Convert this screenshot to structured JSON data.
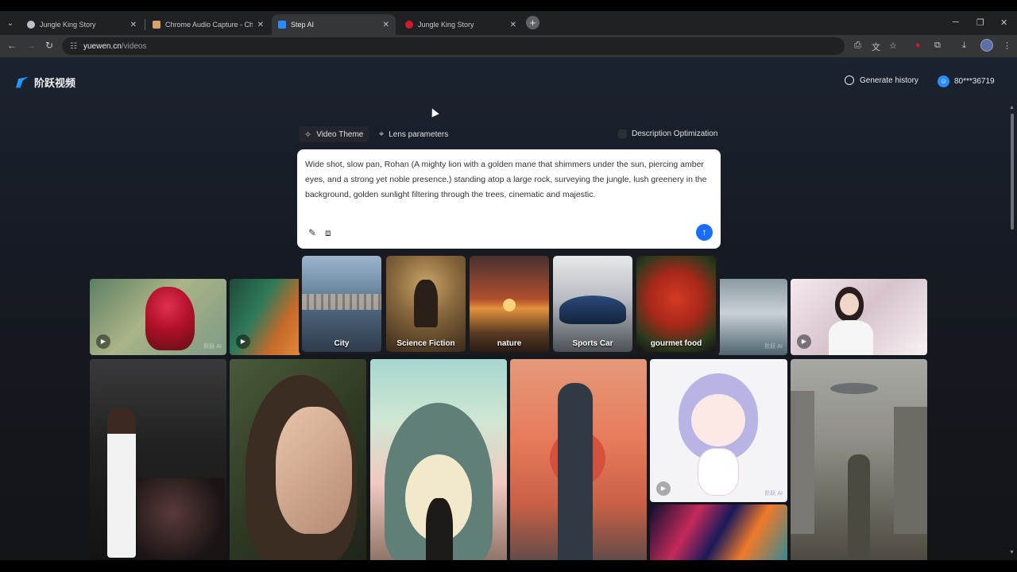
{
  "browser": {
    "tabs": [
      {
        "title": "Jungle King Story",
        "active": false,
        "favicon_color": "#bdc1c6"
      },
      {
        "title": "Chrome Audio Capture - Chrom",
        "active": false,
        "favicon_color": "#d7a36b"
      },
      {
        "title": "Step AI",
        "active": true,
        "favicon_color": "#2a8cff"
      },
      {
        "title": "Jungle King Story",
        "active": false,
        "favicon_color": "#d11a2a"
      }
    ],
    "url_host": "yuewen.cn",
    "url_path": "/videos"
  },
  "header": {
    "logo_text": "阶跃视频",
    "generate_history": "Generate history",
    "user_id": "80***36719"
  },
  "prompt": {
    "mode_tabs": [
      "Video Theme",
      "Lens parameters"
    ],
    "description_optimization": "Description Optimization",
    "text": "Wide shot, slow pan, Rohan (A mighty lion with a golden mane that shimmers under the sun, piercing amber eyes, and a strong yet noble presence.) standing atop a large rock, surveying the jungle, lush greenery in the background, golden sunlight filtering through the trees, cinematic and majestic."
  },
  "themes": [
    {
      "label": "City"
    },
    {
      "label": "Science Fiction"
    },
    {
      "label": "nature"
    },
    {
      "label": "Sports Car"
    },
    {
      "label": "gourmet food"
    }
  ],
  "gallery": {
    "watermark": "阶跃 AI",
    "items": [
      {
        "name": "rooster"
      },
      {
        "name": "forest-fox"
      },
      {
        "name": "waves"
      },
      {
        "name": "girl-cherry-blossom"
      },
      {
        "name": "runway-model"
      },
      {
        "name": "woman-portrait"
      },
      {
        "name": "totoro"
      },
      {
        "name": "deer-warrior"
      },
      {
        "name": "anime-cat-girl"
      },
      {
        "name": "abstract-swirl"
      },
      {
        "name": "ruined-city"
      }
    ]
  },
  "colors": {
    "accent": "#1a6bff",
    "page_bg": "#131418"
  }
}
